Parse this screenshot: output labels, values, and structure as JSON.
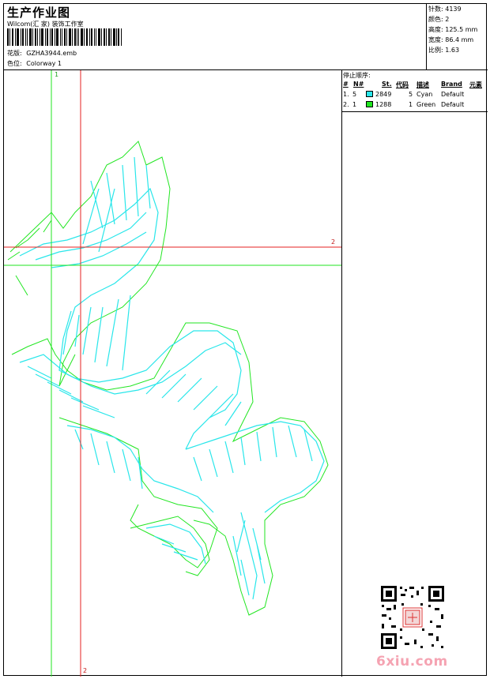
{
  "header": {
    "title": "生产作业图",
    "company": "Wilcom(汇 家) 装饰工作室",
    "design_label": "花版:",
    "design_file": "GZHA3944.emb",
    "colorway_label": "色位:",
    "colorway": "Colorway 1"
  },
  "stats": [
    {
      "label": "针数:",
      "value": "4139"
    },
    {
      "label": "颜色:",
      "value": "2"
    },
    {
      "label": "高度:",
      "value": "125.5 mm"
    },
    {
      "label": "宽度:",
      "value": "86.4 mm"
    },
    {
      "label": "比例:",
      "value": "1.63"
    }
  ],
  "stop_sequence": {
    "title": "停止顺序:",
    "columns": [
      "#",
      "N#",
      "St.",
      "代码",
      "描述",
      "Brand",
      "元素"
    ],
    "rows": [
      {
        "index": "1.",
        "needle": "5",
        "color": "#29e6ea",
        "stitches": "2849",
        "code": "5",
        "description": "Cyan",
        "brand": "Default"
      },
      {
        "index": "2.",
        "needle": "1",
        "color": "#1fe61f",
        "stitches": "1288",
        "code": "1",
        "description": "Green",
        "brand": "Default"
      }
    ]
  },
  "guides": {
    "top_label": "1",
    "right_label": "2",
    "bottom_label": "2"
  },
  "watermark": "6xiu.com"
}
